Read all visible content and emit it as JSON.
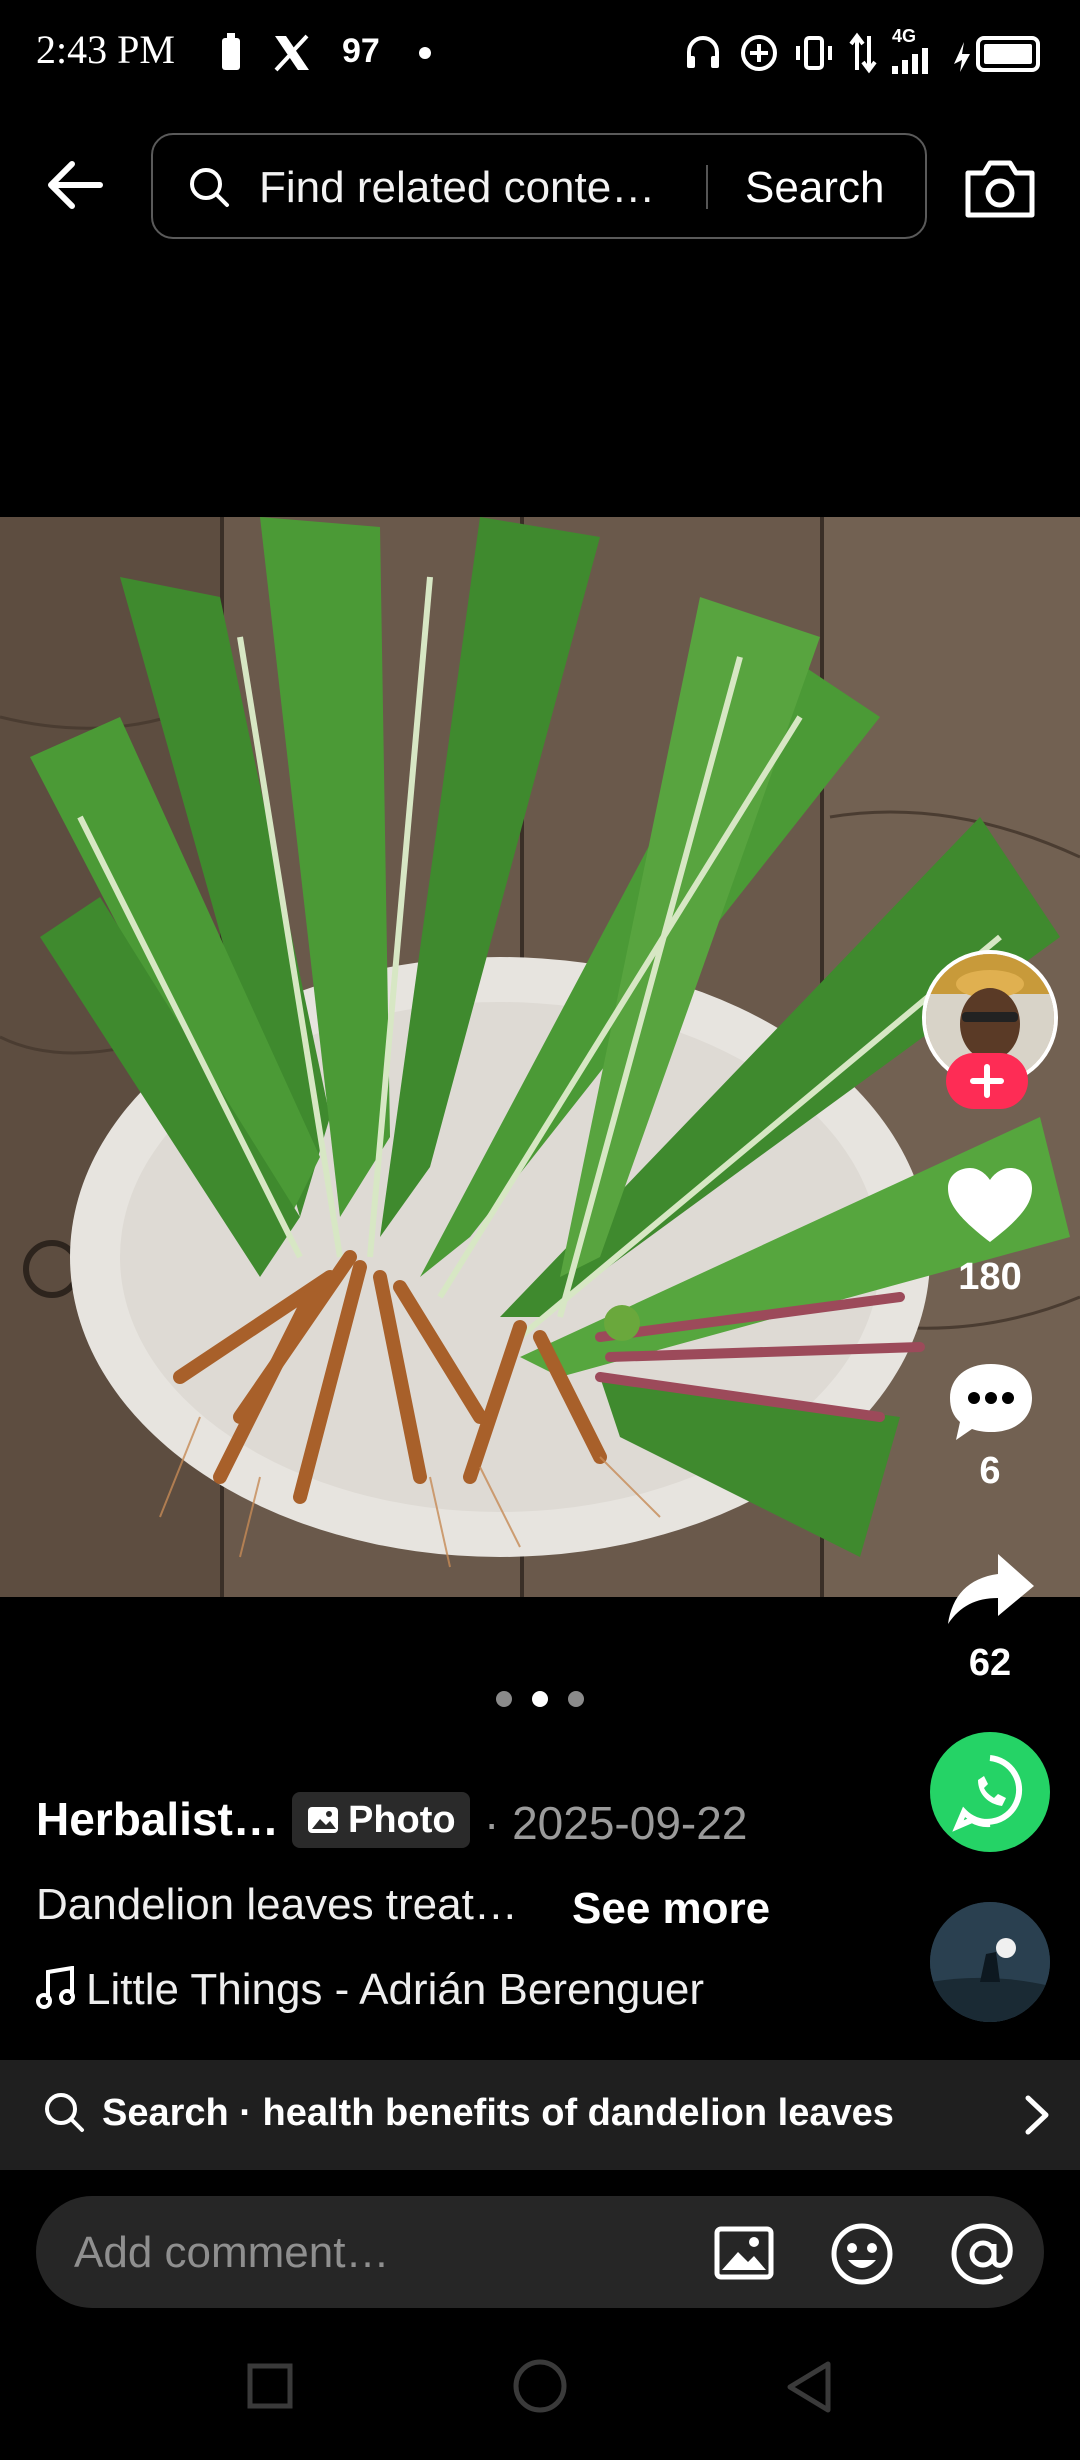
{
  "status_bar": {
    "time": "2:43 PM",
    "notification_text": "97",
    "network": "4G",
    "icons": [
      "battery-small-icon",
      "x-logo-icon",
      "dot-icon",
      "headset-icon",
      "add-circle-icon",
      "vibrate-icon",
      "data-arrows-icon",
      "signal-icon",
      "battery-icon"
    ]
  },
  "search": {
    "placeholder": "Find related conte…",
    "button_label": "Search"
  },
  "post": {
    "author": "Herbalist…",
    "badge_label": "Photo",
    "date": "· 2025-09-22",
    "caption": "Dandelion leaves treat…",
    "see_more_label": "See more",
    "music": "Little Things - Adrián Berenguer",
    "page_indicator": {
      "total": 3,
      "active_index": 1
    }
  },
  "actions": {
    "likes": "180",
    "comments": "6",
    "shares": "62"
  },
  "related_search": {
    "text": "Search · health benefits of dandelion leaves"
  },
  "comment_bar": {
    "placeholder": "Add comment…"
  },
  "colors": {
    "accent_follow": "#fe2c55",
    "whatsapp": "#25d366",
    "background": "#000000"
  }
}
